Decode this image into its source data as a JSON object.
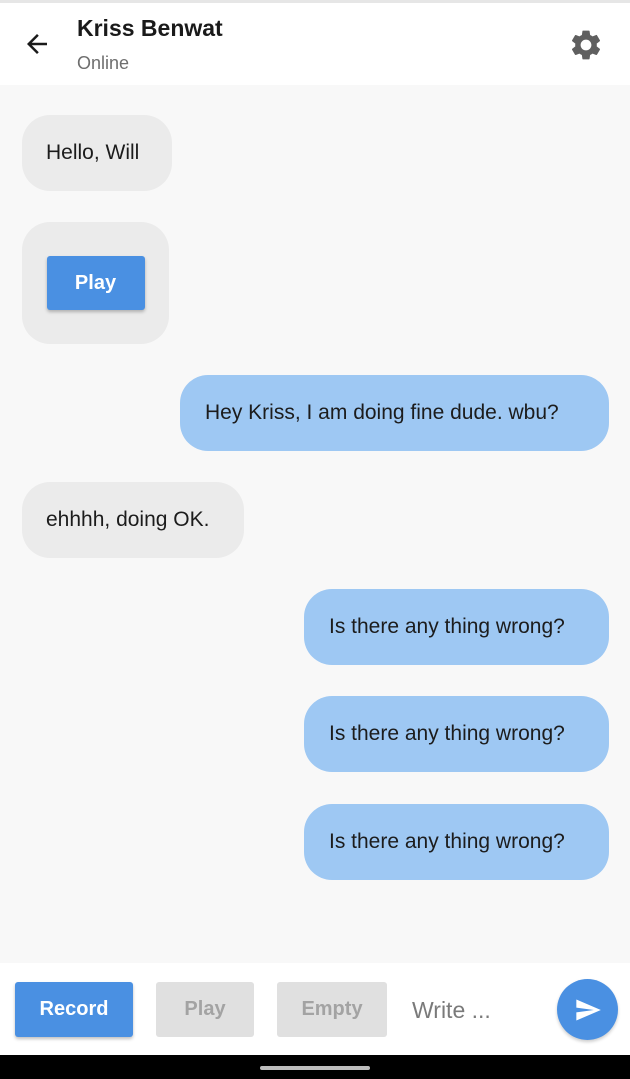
{
  "header": {
    "contact_name": "Kriss Benwat",
    "status": "Online",
    "back_icon": "arrow-left-icon",
    "settings_icon": "gear-icon"
  },
  "messages": [
    {
      "type": "received",
      "text": "Hello, Will"
    },
    {
      "type": "received-audio",
      "button_label": "Play"
    },
    {
      "type": "sent",
      "text": "Hey Kriss, I am doing fine dude. wbu?"
    },
    {
      "type": "received",
      "text": "ehhhh, doing OK."
    },
    {
      "type": "sent",
      "text": "Is there any thing wrong?"
    },
    {
      "type": "sent",
      "text": "Is there any thing wrong?"
    },
    {
      "type": "sent",
      "text": "Is there any thing wrong?"
    }
  ],
  "composer": {
    "record_label": "Record",
    "play_label": "Play",
    "empty_label": "Empty",
    "input_placeholder": "Write ...",
    "input_value": "",
    "send_icon": "send-icon"
  },
  "colors": {
    "accent": "#4a90e2",
    "sent_bubble": "#9ec8f3",
    "received_bubble": "#ebebeb",
    "background": "#f8f8f8"
  }
}
